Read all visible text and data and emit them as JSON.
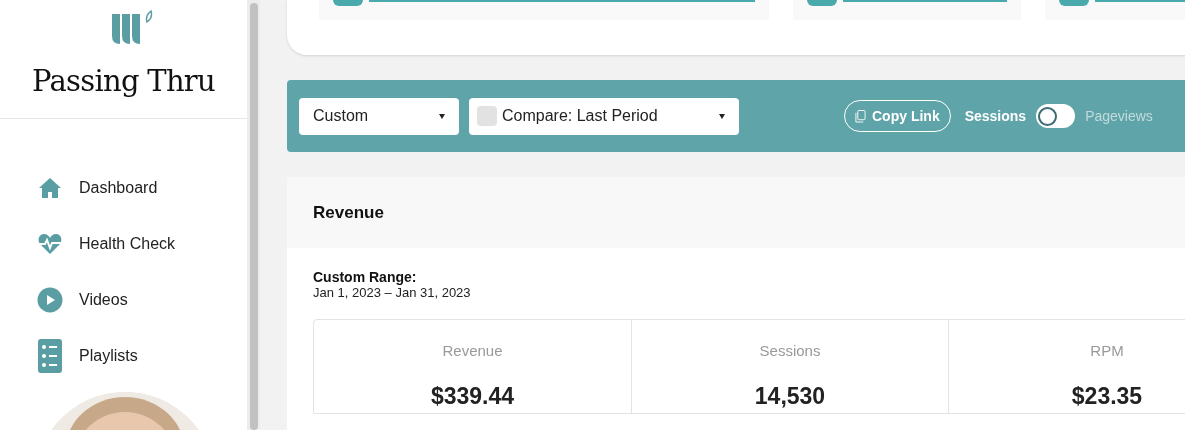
{
  "brand": {
    "name": "Passing Thru"
  },
  "nav": [
    {
      "label": "Dashboard"
    },
    {
      "label": "Health Check"
    },
    {
      "label": "Videos"
    },
    {
      "label": "Playlists"
    }
  ],
  "toolbar": {
    "range_select": "Custom",
    "compare": {
      "label": "Compare: Last Period",
      "checked": false
    },
    "copy_link": "Copy Link",
    "metric_toggle": {
      "left": "Sessions",
      "right": "Pageviews",
      "on": false
    }
  },
  "revenue_panel": {
    "title": "Revenue",
    "range_label": "Custom Range:",
    "range": "Jan 1, 2023 – Jan 31, 2023",
    "stats": [
      {
        "label": "Revenue",
        "value": "$339.44"
      },
      {
        "label": "Sessions",
        "value": "14,530"
      },
      {
        "label": "RPM",
        "value": "$23.35"
      }
    ]
  }
}
